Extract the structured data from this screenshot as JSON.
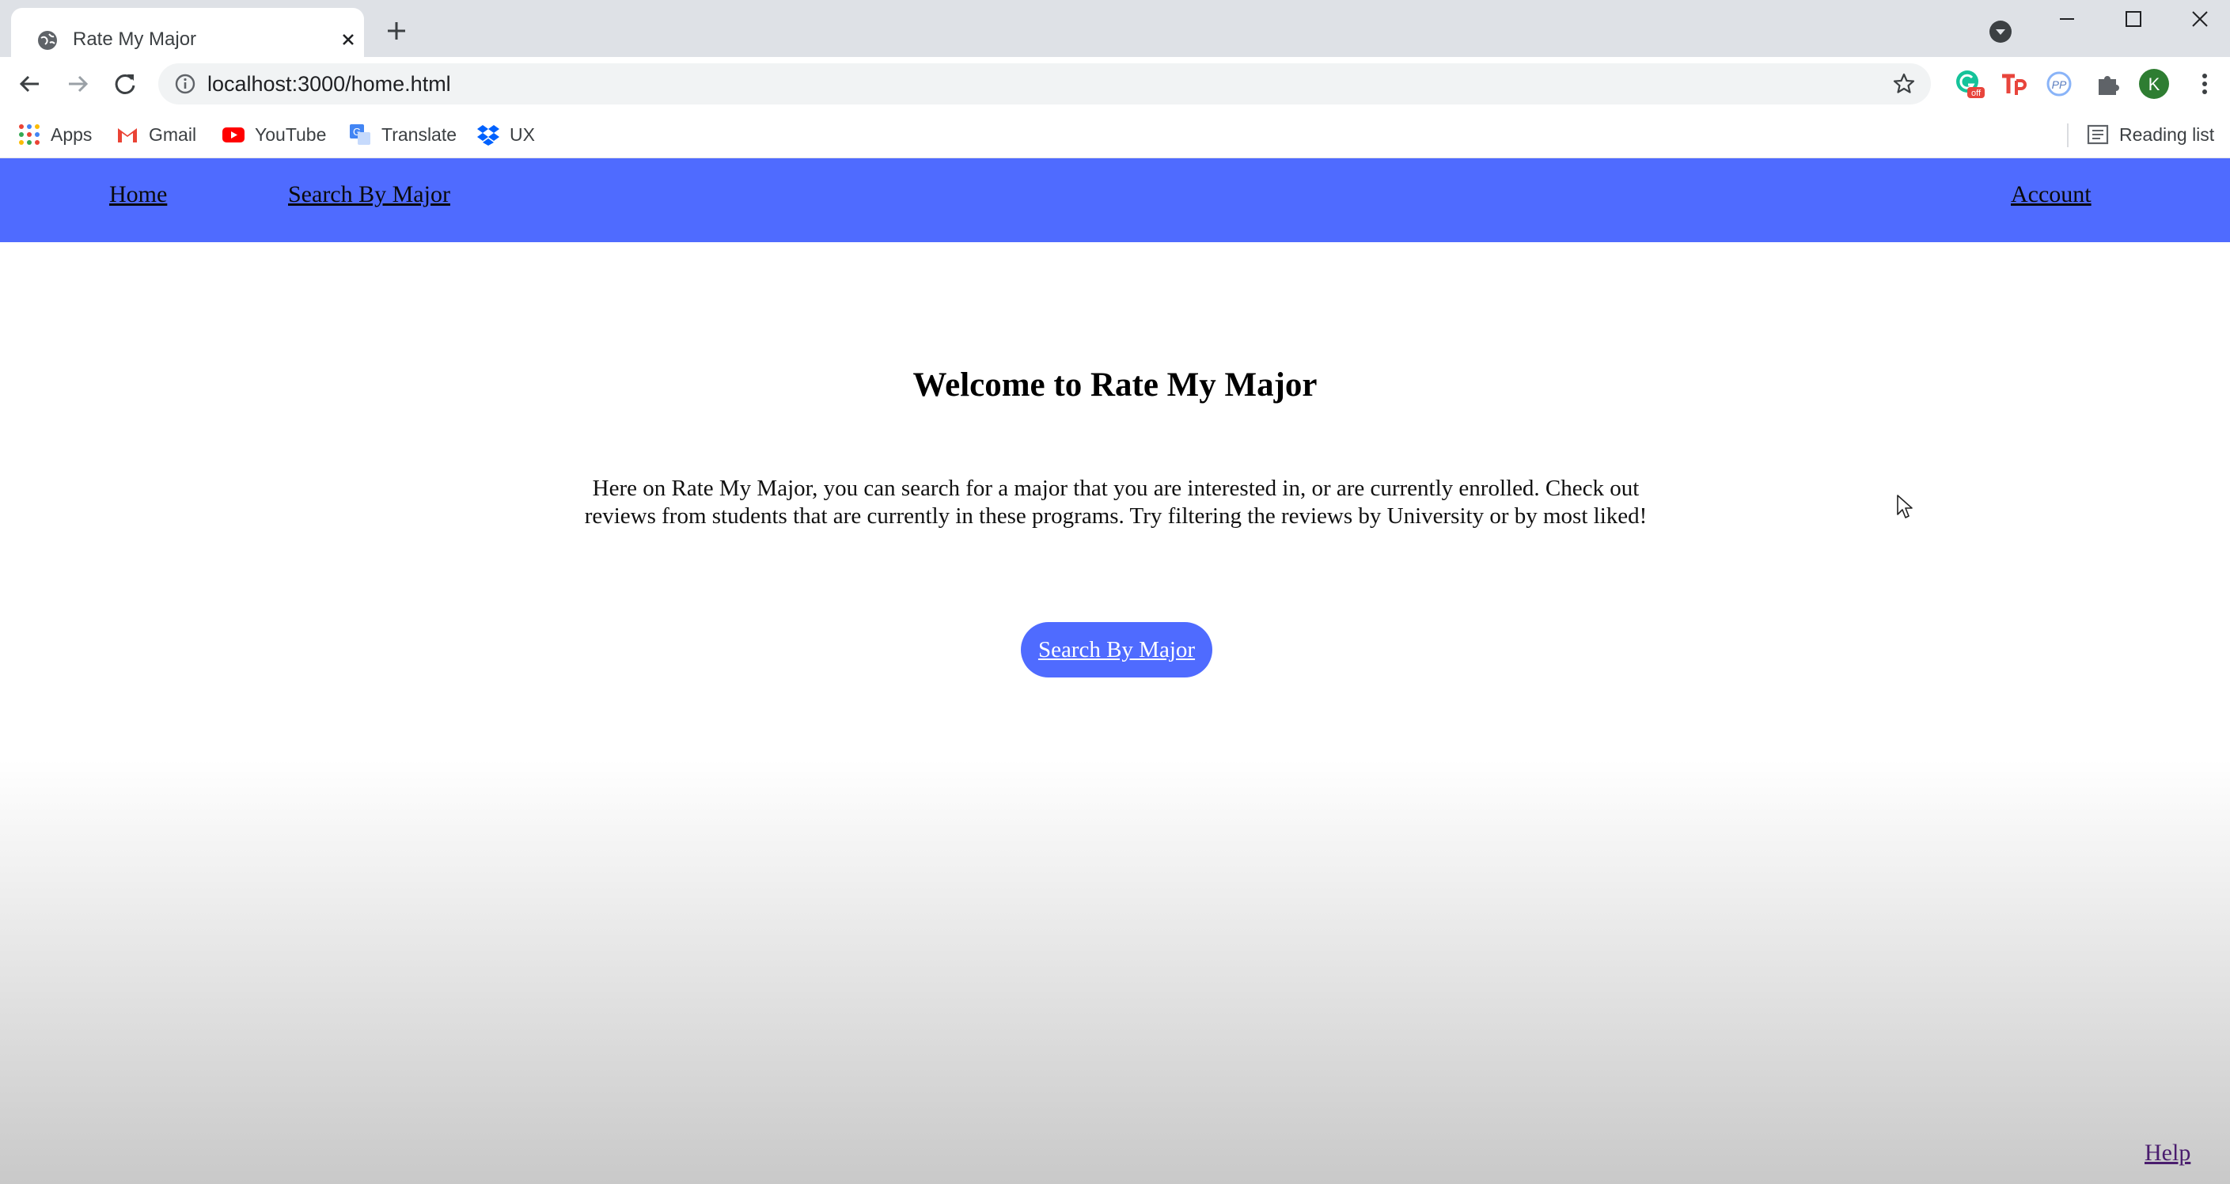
{
  "browser": {
    "tab": {
      "title": "Rate My Major",
      "favicon": "globe-icon"
    },
    "address_bar": {
      "url": "localhost:3000/home.html"
    },
    "bookmarks": [
      {
        "label": "Apps",
        "icon": "apps-grid-icon"
      },
      {
        "label": "Gmail",
        "icon": "gmail-icon"
      },
      {
        "label": "YouTube",
        "icon": "youtube-icon"
      },
      {
        "label": "Translate",
        "icon": "translate-icon"
      },
      {
        "label": "UX",
        "icon": "dropbox-icon"
      }
    ],
    "reading_list_label": "Reading list",
    "profile_initial": "K",
    "extension_badge": "off"
  },
  "site": {
    "nav": {
      "home": "Home",
      "search_by_major": "Search By Major",
      "account": "Account"
    },
    "title": "Welcome to Rate My Major",
    "intro_line1": "Here on Rate My Major, you can search for a major that you are interested in, or are currently enrolled. Check out",
    "intro_line2": "reviews from students that are currently in these programs. Try filtering the reviews by University or by most liked!",
    "cta_label": "Search By Major",
    "help_label": "Help"
  },
  "colors": {
    "nav_bg": "#4f6bff",
    "cta_bg": "#4f6bff",
    "help_link": "#4a1d6e"
  }
}
